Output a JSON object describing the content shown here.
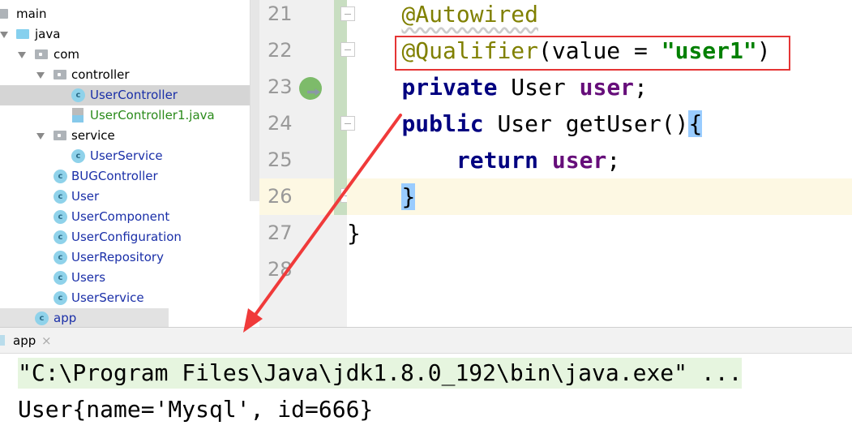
{
  "project_tree": [
    {
      "label": "main",
      "type": "folder",
      "selected": false
    },
    {
      "label": "java",
      "type": "source-folder",
      "expanded": true
    },
    {
      "label": "com",
      "type": "package",
      "expanded": true
    },
    {
      "label": "controller",
      "type": "package",
      "expanded": true
    },
    {
      "label": "UserController",
      "type": "class",
      "selected": true
    },
    {
      "label": "UserController1.java",
      "type": "java-file"
    },
    {
      "label": "service",
      "type": "package",
      "expanded": true
    },
    {
      "label": "UserService",
      "type": "class"
    },
    {
      "label": "BUGController",
      "type": "class"
    },
    {
      "label": "User",
      "type": "class"
    },
    {
      "label": "UserComponent",
      "type": "class"
    },
    {
      "label": "UserConfiguration",
      "type": "class"
    },
    {
      "label": "UserRepository",
      "type": "class"
    },
    {
      "label": "Users",
      "type": "class"
    },
    {
      "label": "UserService",
      "type": "class"
    },
    {
      "label": "app",
      "type": "app-class"
    }
  ],
  "editor": {
    "line_numbers": [
      "21",
      "22",
      "23",
      "24",
      "25",
      "26",
      "27",
      "28"
    ],
    "lines": {
      "l21": {
        "annotation": "@Autowired"
      },
      "l22": {
        "annotation": "@Qualifier",
        "open": "(value = ",
        "string": "\"user1\"",
        "close": ")"
      },
      "l23": {
        "kw": "private",
        "type": " User ",
        "field": "user",
        "end": ";"
      },
      "l24": {
        "kw": "public",
        "rest": " User getUser()",
        "brace": "{"
      },
      "l25": {
        "kw": "return",
        "sp": " ",
        "field": "user",
        "end": ";"
      },
      "l26": {
        "brace": "}"
      },
      "l27": {
        "brace": "}"
      }
    },
    "current_line": "26",
    "highlight_box_color": "#e53535"
  },
  "run_panel": {
    "tab_label": "app",
    "close_icon": "×",
    "command_line": "\"C:\\Program Files\\Java\\jdk1.8.0_192\\bin\\java.exe\" ...",
    "output": "User{name='Mysql', id=666}"
  },
  "colors": {
    "annotation": "#808000",
    "keyword": "#000080",
    "field": "#660e7a",
    "string": "#008000",
    "arrow": "#f03a3a"
  }
}
